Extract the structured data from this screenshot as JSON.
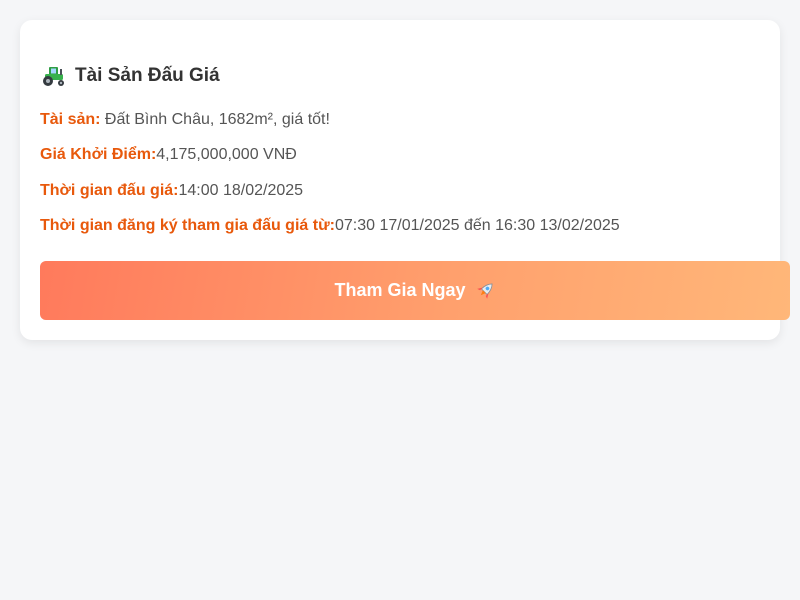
{
  "card": {
    "title": "Tài Sản Đấu Giá",
    "title_icon": "tractor-icon",
    "fields": [
      {
        "label": "Tài sản:",
        "value": " Đất Bình Châu, 1682m², giá tốt!"
      },
      {
        "label": "Giá Khởi Điểm:",
        "value": "4,175,000,000 VNĐ"
      },
      {
        "label": "Thời gian đấu giá:",
        "value": "14:00 18/02/2025"
      },
      {
        "label": "Thời gian đăng ký tham gia đấu giá từ:",
        "value": "07:30 17/01/2025 đến 16:30 13/02/2025"
      }
    ],
    "button": {
      "label": "Tham Gia Ngay",
      "icon": "rocket-icon"
    }
  },
  "colors": {
    "accent": "#e8590c",
    "button_gradient_start": "#ff7a5c",
    "button_gradient_end": "#ffb779",
    "background": "#f5f6f8",
    "card": "#ffffff"
  }
}
